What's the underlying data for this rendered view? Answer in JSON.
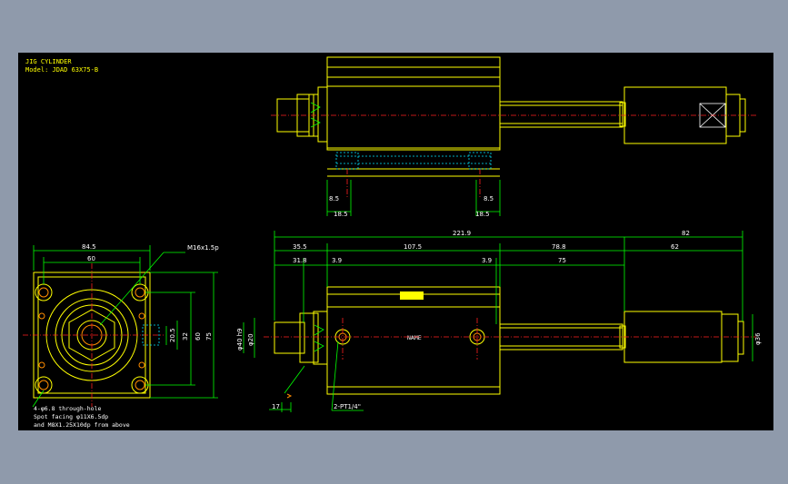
{
  "title_block": {
    "title": "JIG CYLINDER",
    "model": "Model: JDAD 63X75-B"
  },
  "dimensions": {
    "top_left_small": "8.5",
    "top_left_large": "18.5",
    "top_right_small": "8.5",
    "top_right_large": "18.5",
    "side_overall_width": "84.5",
    "side_bolt_pitch": "60",
    "side_thread": "M16x1.5p",
    "side_height_small": "20.5",
    "side_height_mid": "32",
    "side_height_bolt": "60",
    "side_height_overall": "75",
    "side_note_1": "4-φ6.8 through-hole",
    "side_note_2": "Spot facing  φ11X6.5dp",
    "side_note_3": "and M8X1.25X10dp from above",
    "front_overall": "221.9",
    "front_rod_end": "82",
    "front_seg_1": "35.5",
    "front_seg_2": "107.5",
    "front_seg_3": "78.8",
    "front_seg_4": "62",
    "front_sub_1": "31.8",
    "front_sub_2": "3.9",
    "front_sub_3": "3.9",
    "front_sub_4": "75",
    "front_dia_left_1": "φ40 h9",
    "front_dia_left_2": "φ20",
    "front_dia_right": "φ36",
    "front_flat": "17",
    "front_port": "2-PT1/4\"",
    "front_nameplate": "NAME"
  }
}
